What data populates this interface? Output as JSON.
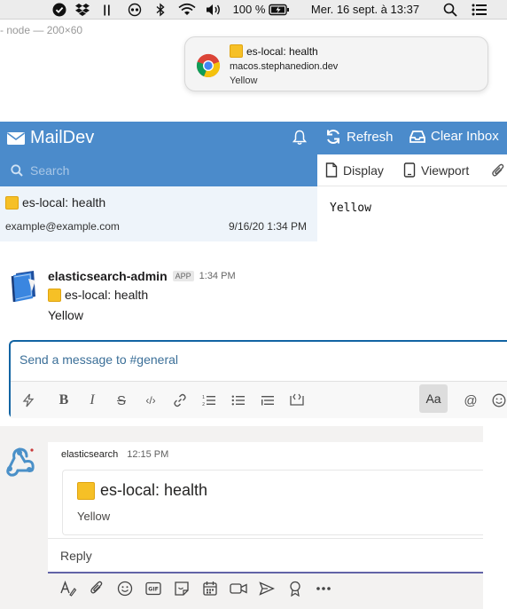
{
  "menubar": {
    "pause_glyph": "||",
    "battery_percent": "100 %",
    "datetime": "Mer. 16 sept. à 13:37"
  },
  "node_label": "- node — 200×60",
  "notification": {
    "title": "es-local: health",
    "subtitle": "macos.stephanedion.dev",
    "body": "Yellow"
  },
  "maildev": {
    "app_name": "MailDev",
    "refresh_label": "Refresh",
    "clear_label": "Clear Inbox",
    "search_placeholder": "Search",
    "email": {
      "subject": "es-local: health",
      "from": "example@example.com",
      "date": "9/16/20 1:34 PM"
    },
    "display_label": "Display",
    "viewport_label": "Viewport",
    "body_text": "Yellow"
  },
  "slack": {
    "user": "elasticsearch-admin",
    "app_badge": "APP",
    "time": "1:34 PM",
    "line1": "es-local: health",
    "line2": "Yellow",
    "composer_placeholder": "Send a message to #general",
    "aa_label": "Aa"
  },
  "teams": {
    "user": "elasticsearch",
    "time": "12:15 PM",
    "card_title": "es-local: health",
    "card_body": "Yellow",
    "reply_placeholder": "Reply"
  },
  "colors": {
    "maildev_blue": "#4b8bcb",
    "slack_focus": "#1264a3",
    "teams_accent": "#6264a7",
    "yellow_square": "#f6c026"
  }
}
